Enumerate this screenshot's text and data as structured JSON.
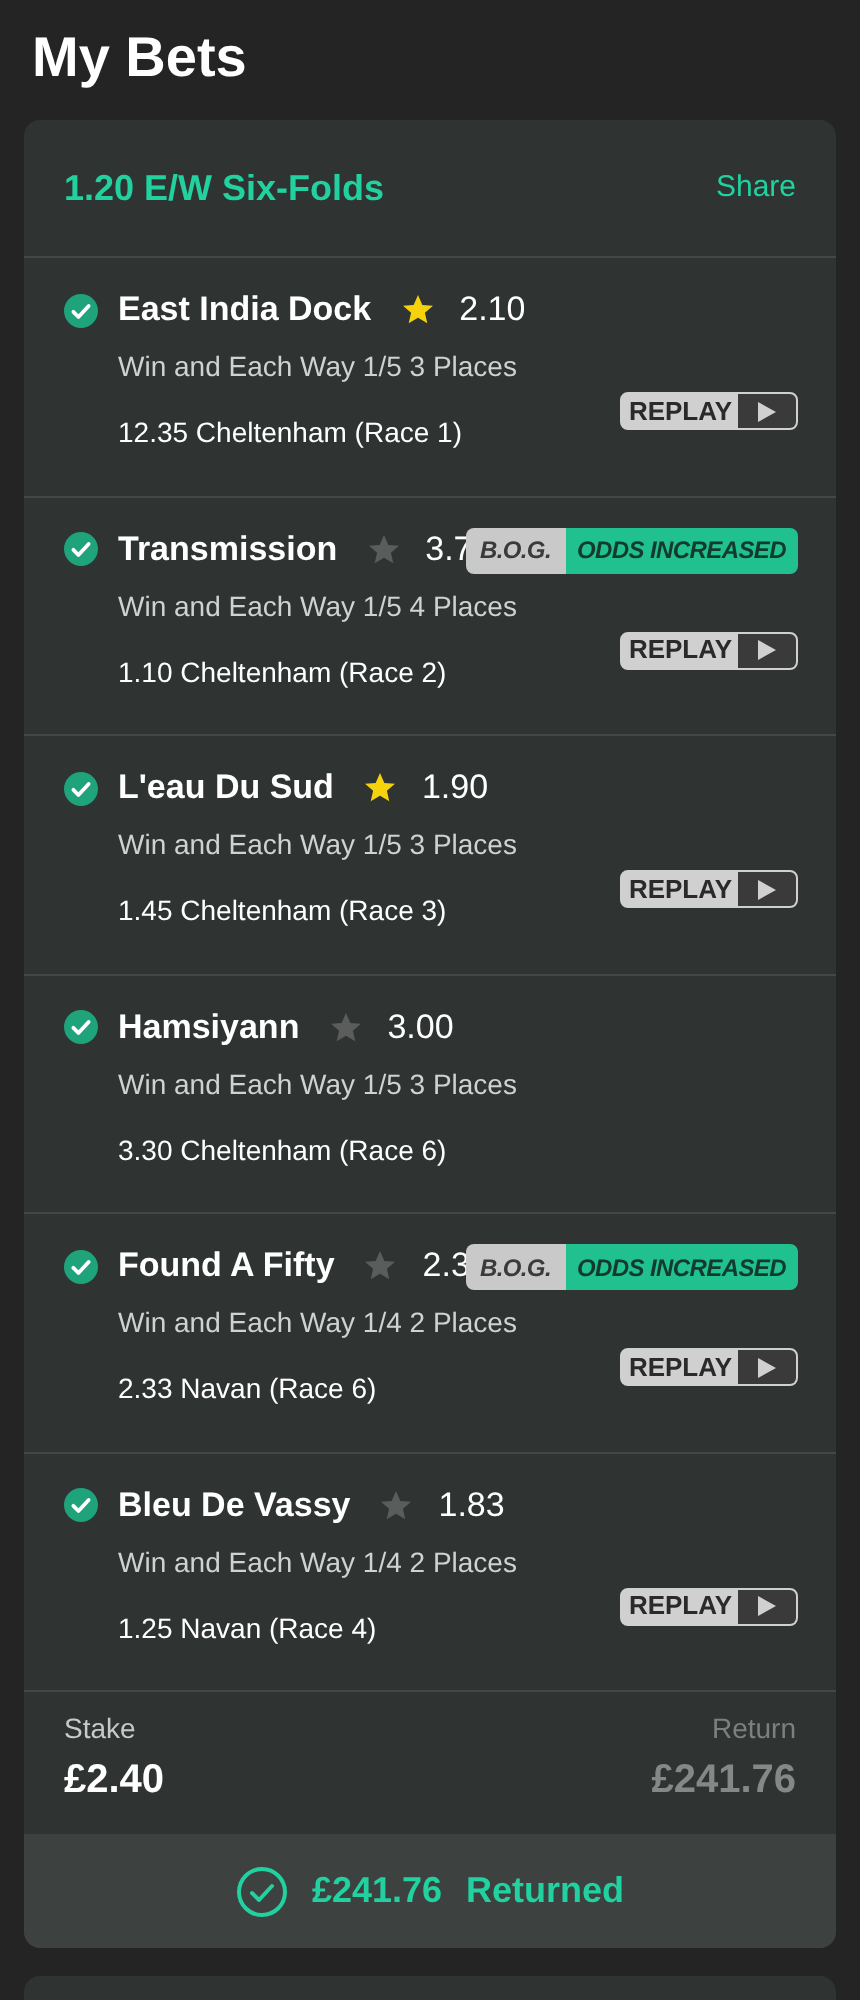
{
  "page_title": "My Bets",
  "bet": {
    "title": "1.20 E/W Six-Folds",
    "share": "Share",
    "legs": [
      {
        "name": "East India Dock",
        "favourite": true,
        "odds": "2.10",
        "market": "Win and Each Way 1/5 3 Places",
        "event": "12.35 Cheltenham (Race 1)",
        "replay": "REPLAY"
      },
      {
        "name": "Transmission",
        "favourite": false,
        "odds": "3.7",
        "badge": {
          "left": "B.O.G.",
          "right": "ODDS INCREASED"
        },
        "market": "Win and Each Way 1/5 4 Places",
        "event": "1.10 Cheltenham (Race 2)",
        "replay": "REPLAY"
      },
      {
        "name": "L'eau Du Sud",
        "favourite": true,
        "odds": "1.90",
        "market": "Win and Each Way 1/5 3 Places",
        "event": "1.45 Cheltenham (Race 3)",
        "replay": "REPLAY"
      },
      {
        "name": "Hamsiyann",
        "favourite": false,
        "odds": "3.00",
        "market": "Win and Each Way 1/5 3 Places",
        "event": "3.30 Cheltenham (Race 6)"
      },
      {
        "name": "Found A Fifty",
        "favourite": false,
        "odds": "2.3",
        "badge": {
          "left": "B.O.G.",
          "right": "ODDS INCREASED"
        },
        "market": "Win and Each Way 1/4 2 Places",
        "event": "2.33 Navan (Race 6)",
        "replay": "REPLAY"
      },
      {
        "name": "Bleu De Vassy",
        "favourite": false,
        "odds": "1.83",
        "market": "Win and Each Way 1/4 2 Places",
        "event": "1.25 Navan (Race 4)",
        "replay": "REPLAY"
      }
    ],
    "stake_label": "Stake",
    "stake": "£2.40",
    "return_label": "Return",
    "return": "£241.76",
    "returned_amount": "£241.76",
    "returned_label": "Returned"
  }
}
